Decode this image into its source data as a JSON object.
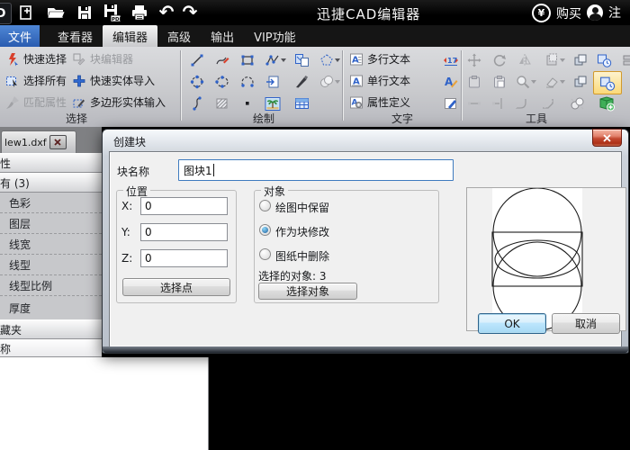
{
  "titlebar": {
    "title": "迅捷CAD编辑器",
    "buy_label": "购买",
    "register_label": "注",
    "icon_names": [
      "app-logo",
      "new-file",
      "open-file",
      "save",
      "save-as-pdf",
      "print",
      "undo",
      "redo",
      "currency-buy",
      "user-register"
    ]
  },
  "tabs": {
    "file": "文件",
    "viewer": "查看器",
    "editor": "编辑器",
    "advanced": "高级",
    "output": "输出",
    "vip": "VIP功能"
  },
  "ribbon": {
    "select_group": {
      "label": "选择",
      "col1": [
        "快速选择",
        "选择所有",
        "匹配属性"
      ],
      "col2": [
        "块编辑器",
        "快速实体导入",
        "多边形实体输入"
      ]
    },
    "draw_group": {
      "label": "绘制",
      "icon_names": [
        "line",
        "spline",
        "rectangle",
        "polyline",
        "insert-block",
        "polygon",
        "circle",
        "ellipse",
        "arc",
        "import-entity",
        "pen",
        "donut",
        "freehand-spline",
        "hatch",
        "point",
        "image",
        "table"
      ]
    },
    "text_group": {
      "label": "文字",
      "items": [
        "多行文本",
        "单行文本",
        "属性定义"
      ],
      "icon_names": [
        "text-scale",
        "text-edit",
        "attribute-edit"
      ]
    },
    "tools_group": {
      "label": "工具",
      "icon_names": [
        "move",
        "rotate",
        "mirror",
        "array",
        "copy-layers",
        "create-block",
        "paste",
        "paste-special",
        "zoom-tool",
        "erase",
        "copy",
        "create-block-active",
        "dim",
        "dim-edit",
        "fillet",
        "chamfer",
        "blend",
        "add-favorite"
      ]
    }
  },
  "sidebar": {
    "doc_tab_label": "lew1.dxf",
    "properties_header": "性",
    "all_header": "有 (3)",
    "property_rows": [
      "色彩",
      "图层",
      "线宽",
      "线型",
      "线型比例",
      "厚度"
    ],
    "favorites_header": "藏夹",
    "name_column_header": "称"
  },
  "dialog": {
    "title": "创建块",
    "name_label": "块名称",
    "name_value": "图块1",
    "position": {
      "label": "位置",
      "x_label": "X:",
      "y_label": "Y:",
      "z_label": "Z:",
      "x_value": "0",
      "y_value": "0",
      "z_value": "0",
      "pick_point_button": "选择点"
    },
    "objects": {
      "label": "对象",
      "option_keep": "绘图中保留",
      "option_convert": "作为块修改",
      "option_delete": "图纸中删除",
      "selected_index": 1,
      "selected_count_label": "选择的对象: 3",
      "select_objects_button": "选择对象"
    },
    "ok_button": "OK",
    "cancel_button": "取消"
  },
  "colors": {
    "accent_blue": "#2f62c8",
    "tab_blue": "#2a5cb0",
    "highlight_orange": "#d29a2c",
    "close_red": "#ad3016",
    "canvas_black": "#000000",
    "radio_selected_blue": "#1f5f9e"
  }
}
